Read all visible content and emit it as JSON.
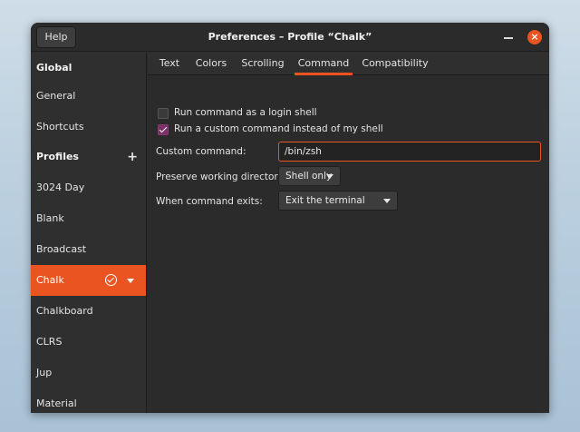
{
  "window": {
    "title": "Preferences – Profile “Chalk”",
    "help_label": "Help",
    "close_glyph": "×"
  },
  "sidebar": {
    "global_header": "Global",
    "general": "General",
    "shortcuts": "Shortcuts",
    "profiles_header": "Profiles",
    "add_glyph": "+",
    "profiles": [
      "3024 Day",
      "Blank",
      "Broadcast",
      "Chalk",
      "Chalkboard",
      "CLRS",
      "Jup",
      "Material"
    ],
    "selected_profile": "Chalk"
  },
  "tabs": [
    "Text",
    "Colors",
    "Scrolling",
    "Command",
    "Compatibility"
  ],
  "active_tab": "Command",
  "command": {
    "login_shell_label": "Run command as a login shell",
    "login_shell_checked": false,
    "custom_cmd_label": "Run a custom command instead of my shell",
    "custom_cmd_checked": true,
    "custom_command_field_label": "Custom command:",
    "custom_command_value": "/bin/zsh",
    "preserve_dir_label": "Preserve working directory:",
    "preserve_dir_value": "Shell only",
    "on_exit_label": "When command exits:",
    "on_exit_value": "Exit the terminal"
  },
  "colors": {
    "accent": "#e95420",
    "window_bg": "#2b2b2b",
    "checkbox_checked": "#7a2f66"
  },
  "icons": [
    "plus-icon",
    "check-circle-icon",
    "chevron-down-icon",
    "close-icon",
    "minimize-icon"
  ]
}
